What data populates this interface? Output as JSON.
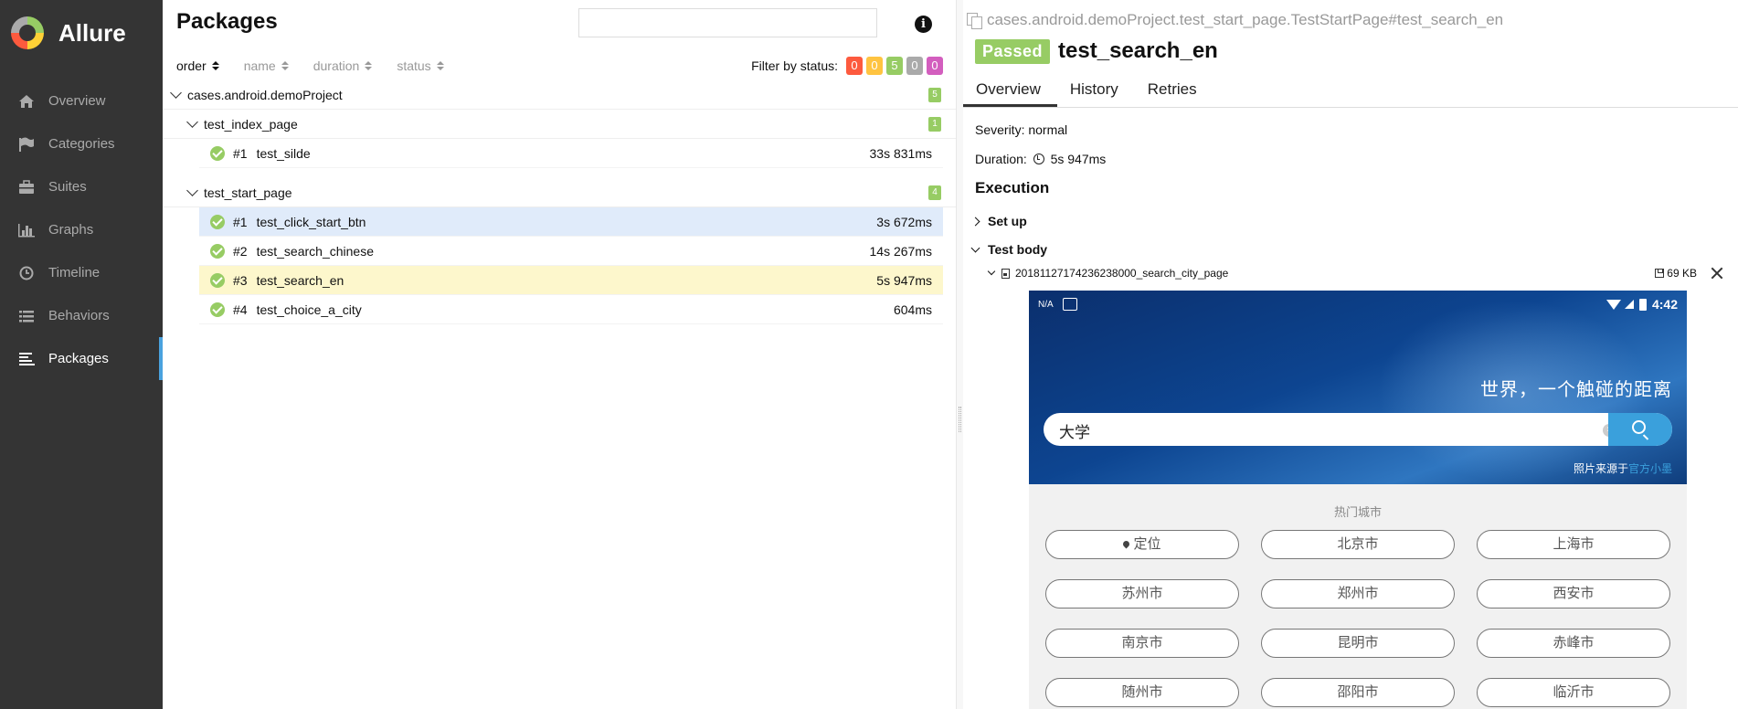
{
  "brand": {
    "name": "Allure"
  },
  "nav": {
    "items": [
      {
        "label": "Overview",
        "icon": "home-icon"
      },
      {
        "label": "Categories",
        "icon": "flag-icon"
      },
      {
        "label": "Suites",
        "icon": "briefcase-icon"
      },
      {
        "label": "Graphs",
        "icon": "bar-chart-icon"
      },
      {
        "label": "Timeline",
        "icon": "clock-icon"
      },
      {
        "label": "Behaviors",
        "icon": "list-icon"
      },
      {
        "label": "Packages",
        "icon": "align-left-icon"
      }
    ],
    "active": "Packages"
  },
  "packages": {
    "title": "Packages",
    "search": {
      "value": "",
      "placeholder": ""
    },
    "sorters": [
      "order",
      "name",
      "duration",
      "status"
    ],
    "filter_label": "Filter by status:",
    "filter_counts": [
      {
        "value": "0",
        "color": "#fd5a3e"
      },
      {
        "value": "0",
        "color": "#ffc441"
      },
      {
        "value": "5",
        "color": "#97cc64"
      },
      {
        "value": "0",
        "color": "#aaaaaa"
      },
      {
        "value": "0",
        "color": "#d35ebe"
      }
    ],
    "root": {
      "name": "cases.android.demoProject",
      "count": "5"
    },
    "groups": [
      {
        "name": "test_index_page",
        "count": "1",
        "tests": [
          {
            "num": "#1",
            "name": "test_silde",
            "duration": "33s 831ms"
          }
        ]
      },
      {
        "name": "test_start_page",
        "count": "4",
        "tests": [
          {
            "num": "#1",
            "name": "test_click_start_btn",
            "duration": "3s 672ms"
          },
          {
            "num": "#2",
            "name": "test_search_chinese",
            "duration": "14s 267ms"
          },
          {
            "num": "#3",
            "name": "test_search_en",
            "duration": "5s 947ms"
          },
          {
            "num": "#4",
            "name": "test_choice_a_city",
            "duration": "604ms"
          }
        ]
      }
    ]
  },
  "detail": {
    "breadcrumb": "cases.android.demoProject.test_start_page.TestStartPage#test_search_en",
    "status": "Passed",
    "name": "test_search_en",
    "tabs": [
      "Overview",
      "History",
      "Retries"
    ],
    "severity": "Severity: normal",
    "duration_label": "Duration:",
    "duration": "5s 947ms",
    "execution": "Execution",
    "setup": "Set up",
    "body": "Test body",
    "attachment": {
      "name": "20181127174236238000_search_city_page",
      "size": "69 KB"
    }
  },
  "phone": {
    "status_left": "N/A",
    "time": "4:42",
    "slogan": "世界，一个触碰的距离",
    "search_value": "大学",
    "credit": "照片来源于",
    "credit_link": "官方小墨",
    "hot_title": "热门城市",
    "cities": [
      "定位",
      "北京市",
      "上海市",
      "苏州市",
      "郑州市",
      "西安市",
      "南京市",
      "昆明市",
      "赤峰市",
      "随州市",
      "邵阳市",
      "临沂市"
    ]
  }
}
